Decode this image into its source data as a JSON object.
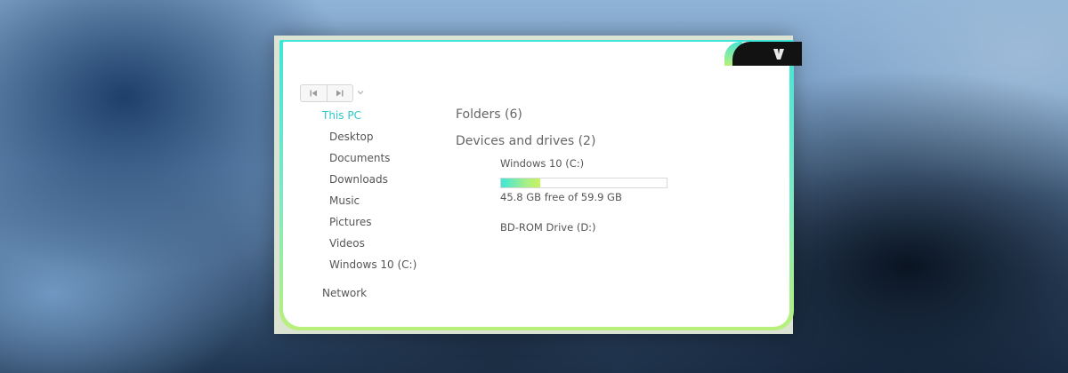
{
  "window": {
    "app_icon": "explorer-v-logo-icon",
    "accent_colors": [
      "#3ee6d8",
      "#b9f07a"
    ]
  },
  "toolbar": {
    "back_icon": "skip-back-icon",
    "forward_icon": "skip-forward-icon",
    "recent_icon": "chevron-down-icon"
  },
  "sidebar": {
    "this_pc": "This PC",
    "items": [
      {
        "label": "Desktop"
      },
      {
        "label": "Documents"
      },
      {
        "label": "Downloads"
      },
      {
        "label": "Music"
      },
      {
        "label": "Pictures"
      },
      {
        "label": "Videos"
      },
      {
        "label": "Windows 10 (C:)"
      }
    ],
    "network": "Network"
  },
  "main": {
    "folders_header": "Folders (6)",
    "devices_header": "Devices and drives (2)",
    "drives": [
      {
        "name": "Windows 10 (C:)",
        "free_text": "45.8 GB free of 59.9 GB",
        "used_fraction": 0.235
      },
      {
        "name": "BD-ROM Drive (D:)"
      }
    ]
  }
}
